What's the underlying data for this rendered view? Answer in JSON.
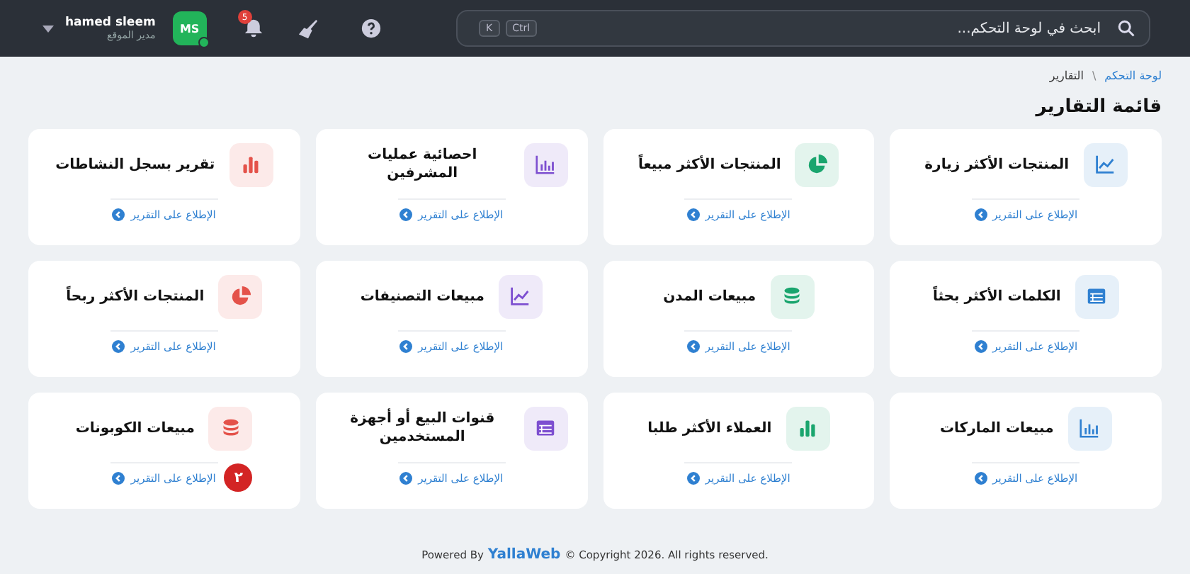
{
  "topbar": {
    "user": {
      "name": "hamed sleem",
      "role": "مدير الموقع",
      "initials": "MS",
      "online": true
    },
    "notifications": {
      "count": "5"
    },
    "search": {
      "placeholder": "ابحث في لوحة التحكم...",
      "keys": [
        "Ctrl",
        "K"
      ]
    }
  },
  "breadcrumb": [
    {
      "label": "لوحة التحكم",
      "link": true
    },
    {
      "label": "التقارير",
      "link": false
    }
  ],
  "breadcrumb_separator": "\\",
  "page_title": "قائمة التقارير",
  "reports": [
    {
      "title": "المنتجات الأكثر زيارة",
      "kind": "line",
      "color": "#2f80d1",
      "link": "الإطلاع على التقرير"
    },
    {
      "title": "المنتجات الأكثر مبيعاً",
      "kind": "pie",
      "color": "#1aa56e",
      "link": "الإطلاع على التقرير"
    },
    {
      "title": "احصائية عمليات المشرفين",
      "kind": "bars",
      "color": "#7d4fd0",
      "link": "الإطلاع على التقرير"
    },
    {
      "title": "تقرير بسجل النشاطات",
      "kind": "columns",
      "color": "#e4524a",
      "link": "الإطلاع على التقرير"
    },
    {
      "title": "الكلمات الأكثر بحثاً",
      "kind": "table",
      "color": "#2f80d1",
      "link": "الإطلاع على التقرير"
    },
    {
      "title": "مبيعات المدن",
      "kind": "coins",
      "color": "#1aa56e",
      "link": "الإطلاع على التقرير"
    },
    {
      "title": "مبيعات التصنيفات",
      "kind": "line",
      "color": "#7d4fd0",
      "link": "الإطلاع على التقرير"
    },
    {
      "title": "المنتجات الأكثر ربحاً",
      "kind": "pie",
      "color": "#e4524a",
      "link": "الإطلاع على التقرير"
    },
    {
      "title": "مبيعات الماركات",
      "kind": "bars",
      "color": "#2f80d1",
      "link": "الإطلاع على التقرير"
    },
    {
      "title": "العملاء الأكثر طلبا",
      "kind": "columns",
      "color": "#1aa56e",
      "link": "الإطلاع على التقرير"
    },
    {
      "title": "قنوات البيع أو أجهزة المستخدمين",
      "kind": "table",
      "color": "#7d4fd0",
      "link": "الإطلاع على التقرير"
    },
    {
      "title": "مبيعات الكوبونات",
      "kind": "coins",
      "color": "#e4524a",
      "link": "الإطلاع على التقرير",
      "badge": "٢"
    }
  ],
  "footer": {
    "before": "Powered By",
    "brand": "YallaWeb",
    "after": "© Copyright 2026. All rights reserved."
  }
}
